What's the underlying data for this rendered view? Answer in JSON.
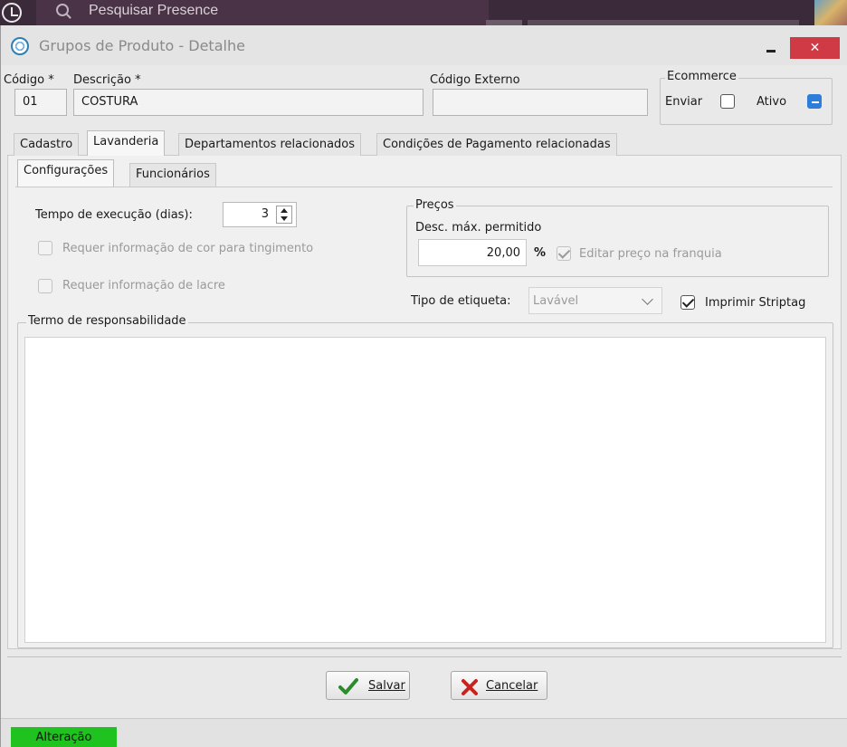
{
  "taskbar": {
    "search_placeholder": "Pesquisar Presence"
  },
  "window": {
    "title": "Grupos de Produto - Detalhe",
    "close_label": "✕"
  },
  "header": {
    "codigo_label": "Código *",
    "codigo_value": "01",
    "descricao_label": "Descrição *",
    "descricao_value": "COSTURA",
    "codigo_externo_label": "Código Externo",
    "codigo_externo_value": "",
    "ecommerce": {
      "title": "Ecommerce",
      "enviar_label": "Enviar",
      "enviar_checked": false,
      "ativo_label": "Ativo",
      "ativo_state": "indeterminate"
    }
  },
  "main_tabs": [
    {
      "label": "Cadastro",
      "active": false
    },
    {
      "label": "Lavanderia",
      "active": true
    },
    {
      "label": "Departamentos relacionados",
      "active": false
    },
    {
      "label": "Condições de Pagamento relacionadas",
      "active": false
    }
  ],
  "sub_tabs": [
    {
      "label": "Configurações",
      "active": true
    },
    {
      "label": "Funcionários",
      "active": false
    }
  ],
  "config": {
    "tempo_label": "Tempo de execução (dias):",
    "tempo_value": "3",
    "requer_cor_label": "Requer informação de cor para tingimento",
    "requer_lacre_label": "Requer informação de lacre",
    "precos": {
      "title": "Preços",
      "desc_label": "Desc. máx. permitido",
      "desc_value": "20,00",
      "percent": "%",
      "editar_label": "Editar preço na franquia"
    },
    "tipo_etiqueta_label": "Tipo de etiqueta:",
    "tipo_etiqueta_value": "Lavável",
    "imprimir_label": "Imprimir Striptag",
    "termo_label": "Termo de responsabilidade",
    "termo_value": ""
  },
  "buttons": {
    "salvar": "Salvar",
    "cancelar": "Cancelar"
  },
  "status": {
    "mode": "Alteração"
  },
  "colors": {
    "status_green": "#1fc21f",
    "close_red": "#d03a44",
    "accent_blue": "#2d7ed9"
  }
}
